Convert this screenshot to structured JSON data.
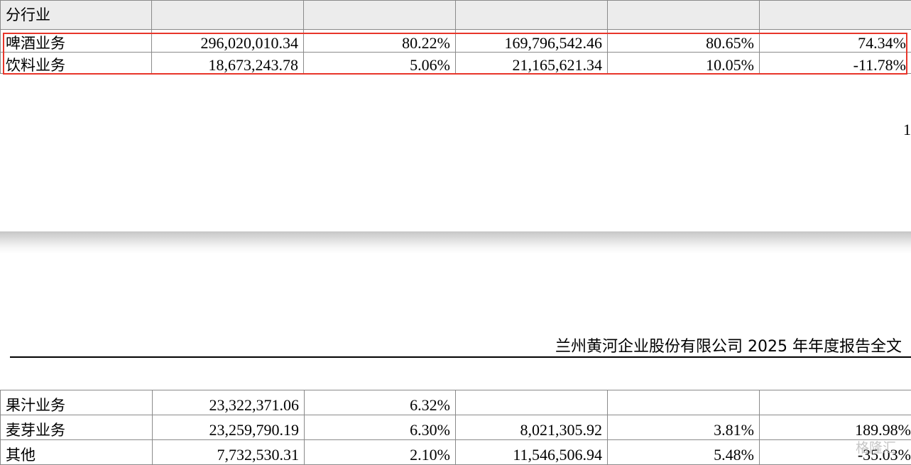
{
  "table_top": {
    "section_label": "分行业",
    "rows": [
      {
        "name": "啤酒业务",
        "c1": "296,020,010.34",
        "c2": "80.22%",
        "c3": "169,796,542.46",
        "c4": "80.65%",
        "c5": "74.34%"
      },
      {
        "name": "饮料业务",
        "c1": "18,673,243.78",
        "c2": "5.06%",
        "c3": "21,165,621.34",
        "c4": "10.05%",
        "c5": "-11.78%"
      }
    ]
  },
  "page_number_fragment": "1",
  "report_header": "兰州黄河企业股份有限公司 2025 年年度报告全文",
  "table_bottom": {
    "rows": [
      {
        "name": "果汁业务",
        "c1": "23,322,371.06",
        "c2": "6.32%",
        "c3": "",
        "c4": "",
        "c5": ""
      },
      {
        "name": "麦芽业务",
        "c1": "23,259,790.19",
        "c2": "6.30%",
        "c3": "8,021,305.92",
        "c4": "3.81%",
        "c5": "189.98%"
      },
      {
        "name": "其他",
        "c1": "7,732,530.31",
        "c2": "2.10%",
        "c3": "11,546,506.94",
        "c4": "5.48%",
        "c5": "-35.03%"
      }
    ]
  },
  "watermark": "格隆汇",
  "colors": {
    "highlight": "#e8352a",
    "section_bg": "#ececec"
  }
}
